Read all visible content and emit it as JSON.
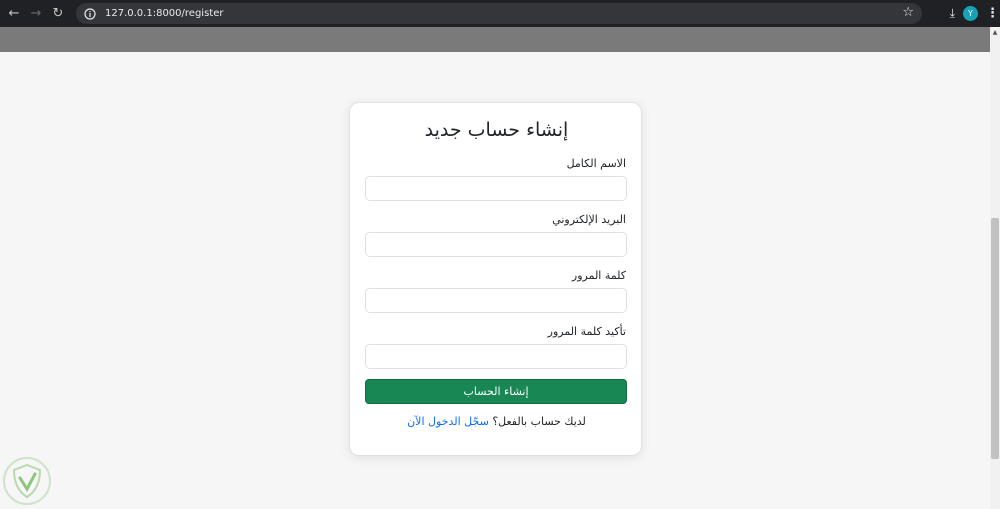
{
  "browser": {
    "url": "127.0.0.1:8000/register",
    "avatar_letter": "Y",
    "icons": [
      "back-arrow-icon",
      "forward-arrow-icon",
      "reload-icon",
      "site-info-icon",
      "bookmark-star-icon",
      "download-icon",
      "profile-avatar",
      "menu-kebab-icon"
    ]
  },
  "form": {
    "title": "إنشاء حساب جديد",
    "fields": [
      {
        "label": "الاسم الكامل",
        "value": ""
      },
      {
        "label": "البريد الإلكتروني",
        "value": ""
      },
      {
        "label": "كلمة المرور",
        "value": ""
      },
      {
        "label": "تأكيد كلمة المرور",
        "value": ""
      }
    ],
    "submit_label": "إنشاء الحساب",
    "footer_text": "لديك حساب بالفعل؟",
    "login_link": "سجّل الدخول الآن"
  },
  "colors": {
    "primary_button": "#198754",
    "link": "#0d6efd",
    "header_band": "#7a7a7a",
    "chrome": "#202124"
  }
}
